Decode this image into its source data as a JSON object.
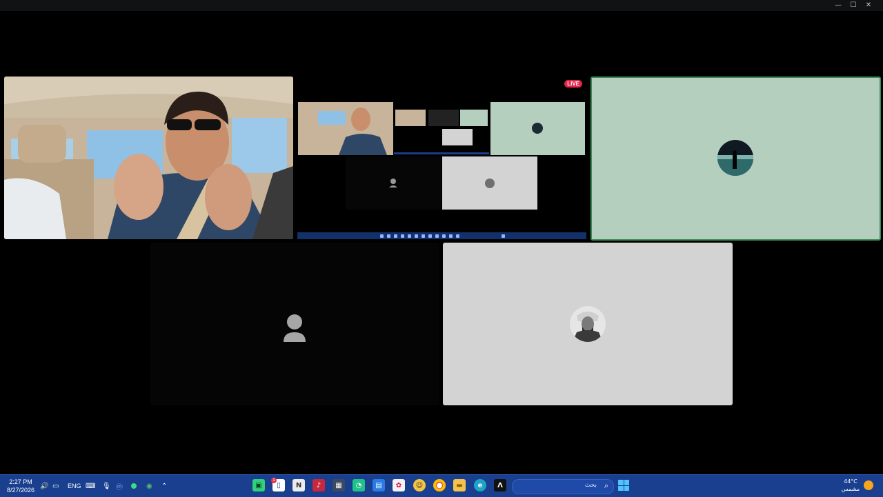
{
  "window": {
    "controls": {
      "minimize_glyph": "—",
      "maximize_glyph": "☐",
      "close_glyph": "✕"
    }
  },
  "shared_screen": {
    "live_badge": "LIVE"
  },
  "taskbar": {
    "time": "2:27 PM",
    "date": "8/27/2026",
    "language": "ENG",
    "search_placeholder": "بحث",
    "weather_temp": "44°C",
    "weather_condition": "مشمس",
    "notification_count": "1",
    "apps": [
      "android-app-icon",
      "files-app-icon",
      "notepad-app-icon",
      "media-app-icon",
      "calculator-app-icon",
      "chat-app-icon",
      "store-app-icon",
      "photos-app-icon",
      "discord-app-icon",
      "chrome-app-icon",
      "file-explorer-app-icon",
      "edge-app-icon",
      "text-app-icon"
    ]
  },
  "colors": {
    "green_tile": "#b5cfbe",
    "green_border": "#3d8c56",
    "grey_tile": "#d3d3d3",
    "taskbar": "#1a3f8f",
    "live": "#e3244b"
  }
}
